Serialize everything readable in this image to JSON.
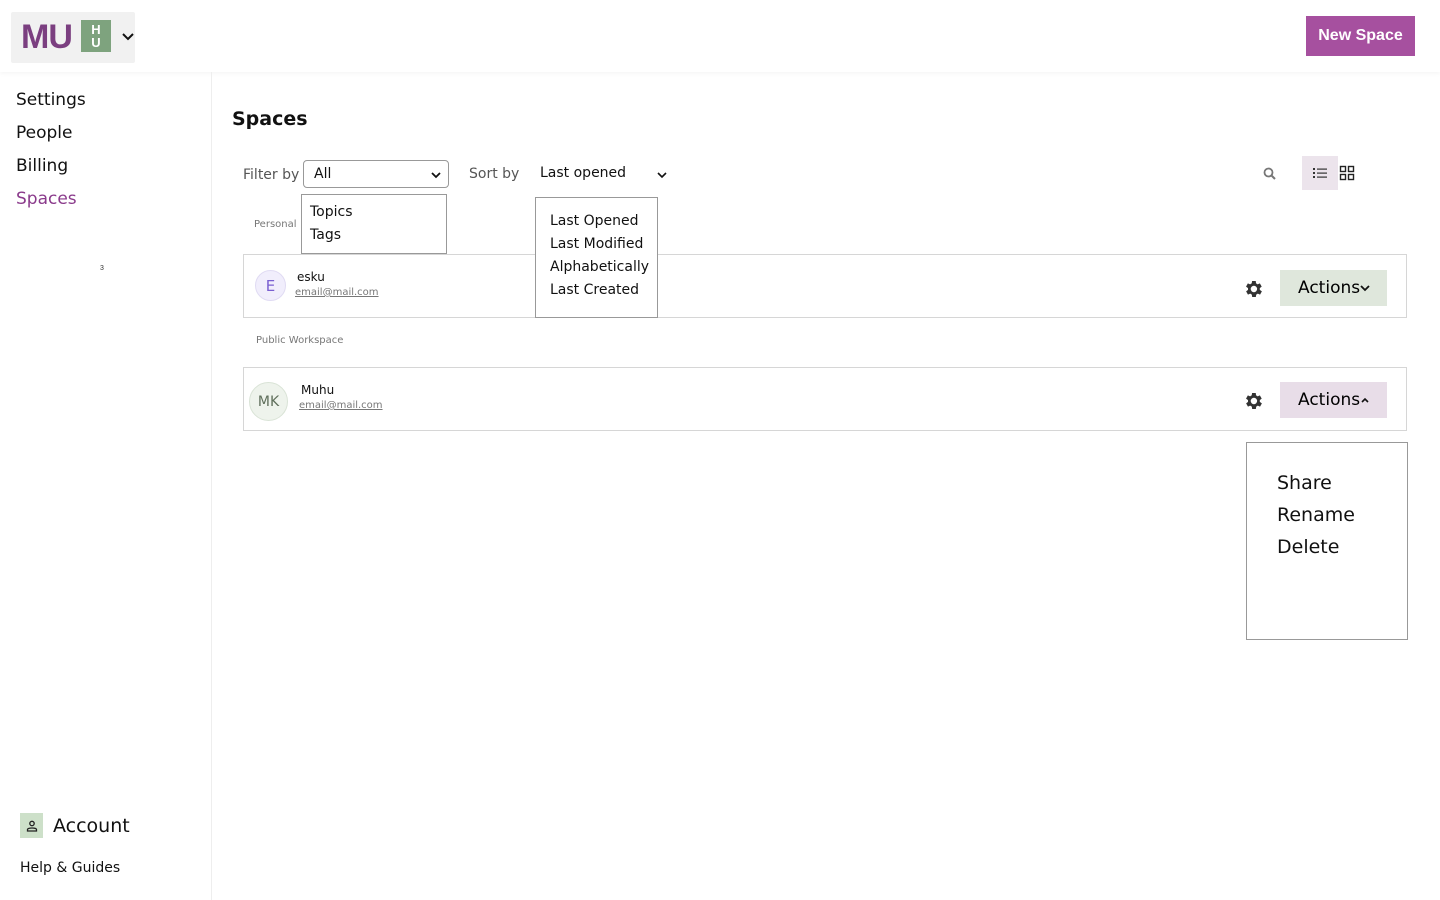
{
  "header": {
    "logo_text": "MU",
    "logo_box_top": "H",
    "logo_box_bottom": "U",
    "new_space_label": "New Space"
  },
  "sidebar": {
    "items": [
      {
        "label": "Settings",
        "active": false
      },
      {
        "label": "People",
        "active": false
      },
      {
        "label": "Billing",
        "active": false
      },
      {
        "label": "Spaces",
        "active": true
      }
    ],
    "tiny_mark": "3",
    "account_label": "Account",
    "help_label": "Help & Guides"
  },
  "main": {
    "title": "Spaces",
    "filter": {
      "label": "Filter by",
      "selected": "All",
      "options": [
        "Topics",
        "Tags"
      ]
    },
    "sort": {
      "label": "Sort by",
      "selected": "Last opened",
      "options": [
        "Last Opened",
        "Last Modified",
        "Alphabetically",
        "Last Created"
      ]
    },
    "sections": [
      {
        "label": "Personal",
        "spaces": [
          {
            "initials": "E",
            "name": "esku",
            "email": "email@mail.com",
            "actions_label": "Actions"
          }
        ]
      },
      {
        "label": "Public Workspace",
        "spaces": [
          {
            "initials": "MK",
            "name": "Muhu",
            "email": "email@mail.com",
            "actions_label": "Actions"
          }
        ]
      }
    ],
    "actions_menu": [
      "Share",
      "Rename",
      "Delete"
    ]
  },
  "colors": {
    "brand": "#a6509f",
    "active_nav": "#8a3a8b",
    "logo_green": "#7ea37e",
    "actions_green_bg": "#dfe7dc",
    "actions_purple_bg": "#e8dde8"
  },
  "icons": [
    "chevron-down-icon",
    "search-icon",
    "list-view-icon",
    "grid-view-icon",
    "gear-icon",
    "user-icon",
    "chevron-up-icon"
  ]
}
